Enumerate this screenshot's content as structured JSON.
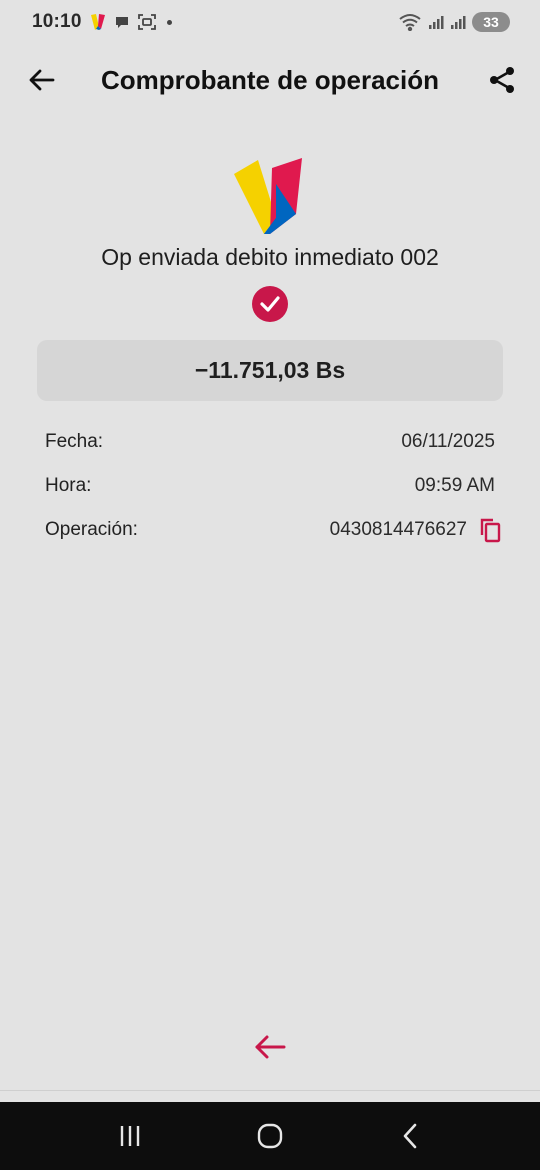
{
  "status_bar": {
    "time": "10:10",
    "battery": "33",
    "icons": [
      "app-logo-icon",
      "chat-icon",
      "screenshot-icon",
      "dot-icon",
      "wifi-icon",
      "signal-icon",
      "signal-icon",
      "battery-icon"
    ]
  },
  "app_bar": {
    "title": "Comprobante de operación",
    "back_icon": "arrow-left-icon",
    "share_icon": "share-icon"
  },
  "receipt": {
    "operation_title": "Op enviada debito inmediato 002",
    "status_icon": "check-circle-icon",
    "amount": "−11.751,03 Bs",
    "details": [
      {
        "label": "Fecha:",
        "value": "06/11/2025"
      },
      {
        "label": "Hora:",
        "value": "09:59 AM"
      },
      {
        "label": "Operación:",
        "value": "0430814476627"
      }
    ],
    "copy_icon": "copy-icon"
  },
  "colors": {
    "accent": "#c8174a",
    "background": "#e3e3e3",
    "amount_box": "#d6d6d6",
    "logo_yellow": "#f5d100",
    "logo_red": "#e0194e",
    "logo_blue": "#0066c0"
  },
  "nav_bar": {
    "icons": [
      "recent-apps-icon",
      "home-icon",
      "back-icon"
    ]
  }
}
